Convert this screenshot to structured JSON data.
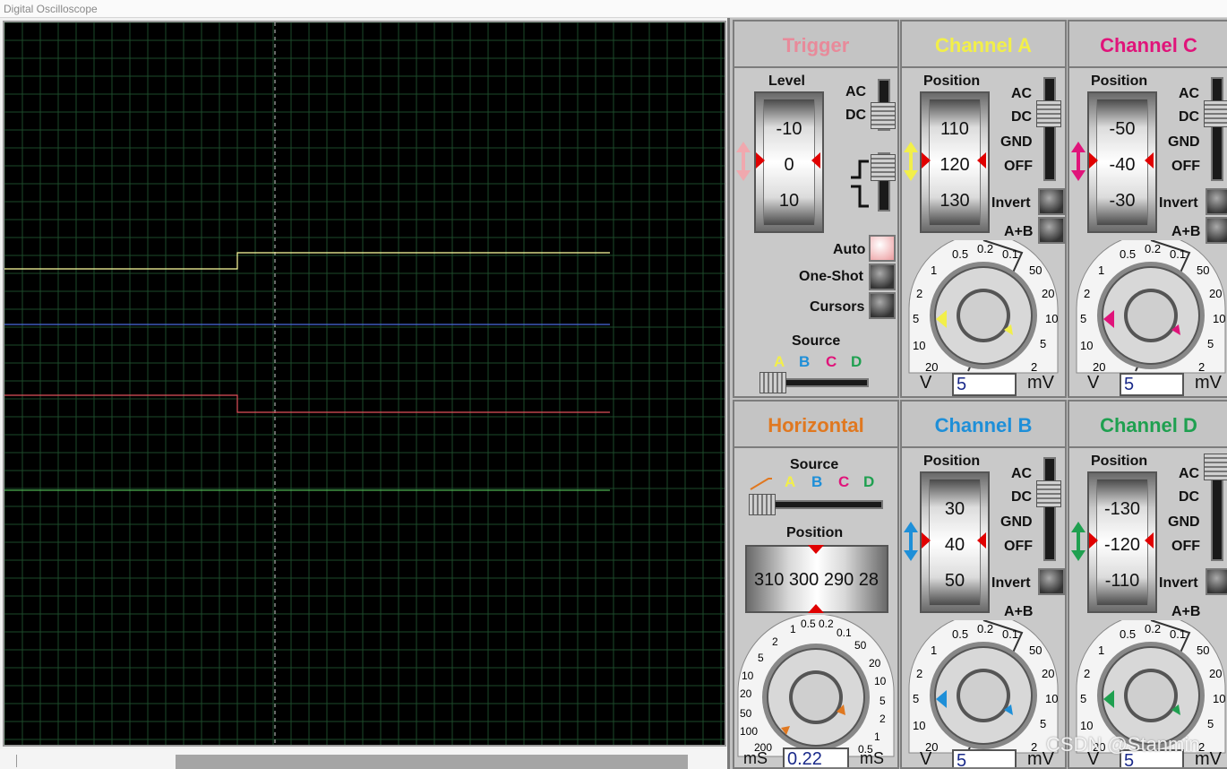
{
  "window": {
    "title": "Digital Oscilloscope"
  },
  "colors": {
    "channel_a": "#f2ef4a",
    "channel_b": "#1e8fd8",
    "channel_c": "#e0147a",
    "channel_d": "#1fa050",
    "trigger": "#e88a9a",
    "horizontal": "#e07820",
    "trace_a": "#ffffa0",
    "trace_b": "#4a6adc",
    "trace_c": "#e0505a",
    "trace_d": "#4cb050",
    "grid": "#1c4a2a"
  },
  "trigger": {
    "title": "Trigger",
    "level_label": "Level",
    "drum": [
      "-10",
      "0",
      "10"
    ],
    "coupling": [
      "AC",
      "DC"
    ],
    "buttons": {
      "auto": "Auto",
      "one_shot": "One-Shot",
      "cursors": "Cursors"
    },
    "source_label": "Source",
    "sources": [
      "A",
      "B",
      "C",
      "D"
    ]
  },
  "channel_a": {
    "title": "Channel A",
    "position_label": "Position",
    "drum": [
      "110",
      "120",
      "130"
    ],
    "coupling": [
      "AC",
      "DC",
      "GND",
      "OFF"
    ],
    "invert": "Invert",
    "a_plus_b": "A+B",
    "value": "5",
    "unit_left": "V",
    "unit_right": "mV",
    "dial_labels": {
      "t05": "0.5",
      "t02": "0.2",
      "t01": "0.1",
      "t50": "50",
      "t20r": "20",
      "t10r": "10",
      "t5r": "5",
      "t2r": "2",
      "t1": "1",
      "t2": "2",
      "t5": "5",
      "t10": "10",
      "t20": "20"
    }
  },
  "channel_c": {
    "title": "Channel C",
    "position_label": "Position",
    "drum": [
      "-50",
      "-40",
      "-30"
    ],
    "coupling": [
      "AC",
      "DC",
      "GND",
      "OFF"
    ],
    "invert": "Invert",
    "a_plus_b": "A+B",
    "value": "5",
    "unit_left": "V",
    "unit_right": "mV",
    "dial_labels": {
      "t05": "0.5",
      "t02": "0.2",
      "t01": "0.1",
      "t50": "50",
      "t20r": "20",
      "t10r": "10",
      "t5r": "5",
      "t2r": "2",
      "t1": "1",
      "t2": "2",
      "t5": "5",
      "t10": "10",
      "t20": "20"
    }
  },
  "horizontal": {
    "title": "Horizontal",
    "source_label": "Source",
    "sources": [
      "A",
      "B",
      "C",
      "D"
    ],
    "position_label": "Position",
    "drum": "310 300 290 28",
    "value": "0.22",
    "unit_left": "mS",
    "unit_right": "mS",
    "dial_labels": {
      "t2": "2",
      "t1": "1",
      "t05": "0.5",
      "t02": "0.2",
      "t01": "0.1",
      "t5": "5",
      "t10": "10",
      "t20": "20",
      "t50": "50",
      "t100": "100",
      "t200": "200",
      "t50r": "50",
      "t20r": "20",
      "t10r": "10",
      "t5r": "5",
      "t2r": "2",
      "t1r": "1",
      "t05r": "0.5"
    }
  },
  "channel_b": {
    "title": "Channel B",
    "position_label": "Position",
    "drum": [
      "30",
      "40",
      "50"
    ],
    "coupling": [
      "AC",
      "DC",
      "GND",
      "OFF"
    ],
    "invert": "Invert",
    "a_plus_b": "A+B",
    "value": "5",
    "unit_left": "V",
    "unit_right": "mV",
    "dial_labels": {
      "t05": "0.5",
      "t02": "0.2",
      "t01": "0.1",
      "t50": "50",
      "t20r": "20",
      "t10r": "10",
      "t5r": "5",
      "t2r": "2",
      "t1": "1",
      "t2": "2",
      "t5": "5",
      "t10": "10",
      "t20": "20"
    }
  },
  "channel_d": {
    "title": "Channel D",
    "position_label": "Position",
    "drum": [
      "-130",
      "-120",
      "-110"
    ],
    "coupling": [
      "AC",
      "DC",
      "GND",
      "OFF"
    ],
    "invert": "Invert",
    "a_plus_b": "A+B",
    "value": "5",
    "unit_left": "V",
    "unit_right": "mV",
    "dial_labels": {
      "t05": "0.5",
      "t02": "0.2",
      "t01": "0.1",
      "t50": "50",
      "t20r": "20",
      "t10r": "10",
      "t5r": "5",
      "t2r": "2",
      "t1": "1",
      "t2": "2",
      "t5": "5",
      "t10": "10",
      "t20": "20"
    }
  },
  "watermark": "CSDN @Stanmin"
}
